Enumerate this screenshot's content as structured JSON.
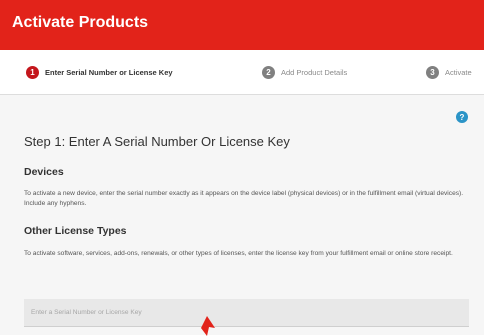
{
  "header": {
    "title": "Activate Products"
  },
  "stepper": {
    "steps": [
      {
        "number": "1",
        "label": "Enter Serial Number or License Key"
      },
      {
        "number": "2",
        "label": "Add Product Details"
      },
      {
        "number": "3",
        "label": "Activate"
      }
    ],
    "active_step": "1"
  },
  "main": {
    "help_glyph": "?",
    "step_title": "Step 1: Enter A Serial Number Or License Key",
    "devices": {
      "title": "Devices",
      "description": "To activate a new device, enter the serial number exactly as it appears on the device label (physical devices) or in the fulfillment email (virtual devices). Include any hyphens."
    },
    "other": {
      "title": "Other License Types",
      "description": "To activate software, services, add-ons, renewals, or other types of licenses, enter the license key from your fulfillment email or online store receipt."
    },
    "serial_input": {
      "placeholder": "Enter a Serial Number or License Key",
      "value": ""
    }
  },
  "colors": {
    "header": "#e2231a",
    "active_step": "#c4161c",
    "help": "#2b94c7",
    "content_bg": "#f6f6f6"
  },
  "icons": {
    "help": "help-icon",
    "cursor": "cursor-arrow-icon"
  }
}
